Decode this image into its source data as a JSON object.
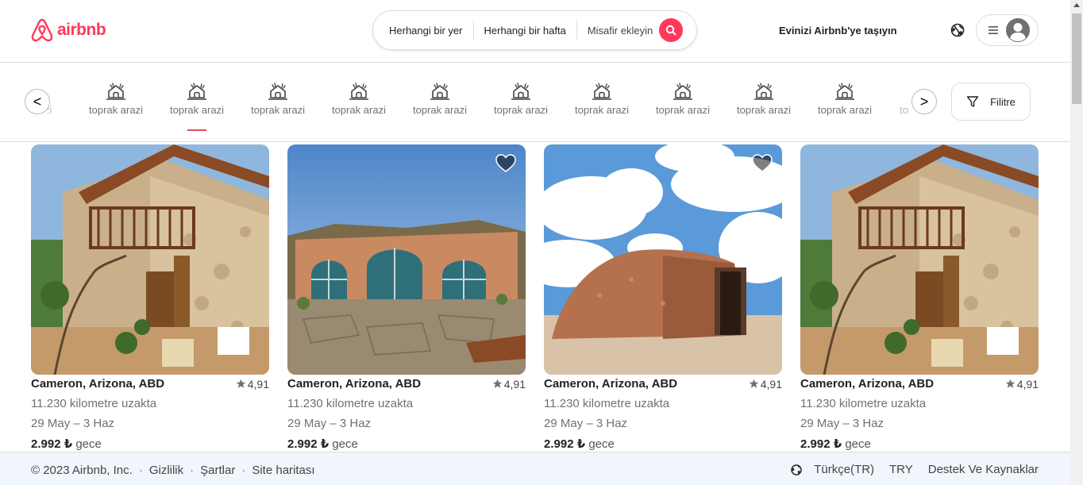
{
  "header": {
    "logo_text": "airbnb",
    "search": {
      "where": "Herhangi bir yer",
      "when": "Herhangi bir hafta",
      "guests": "Misafir ekleyin"
    },
    "host_link": "Evinizi Airbnb'ye taşıyın"
  },
  "categories": {
    "partial_left": "azi",
    "items": [
      "toprak arazi",
      "toprak arazi",
      "toprak arazi",
      "toprak arazi",
      "toprak arazi",
      "toprak arazi",
      "toprak arazi",
      "toprak arazi",
      "toprak arazi",
      "toprak arazi"
    ],
    "partial_right": "top",
    "active_index": 1,
    "prev_label": "<",
    "next_label": ">",
    "filter_label": "Filitre"
  },
  "listings": [
    {
      "title": "Cameron, Arizona, ABD",
      "rating": "4,91",
      "distance": "11.230 kilometre uzakta",
      "dates": "29 May – 3 Haz",
      "price": "2.992 ₺",
      "unit": "gece"
    },
    {
      "title": "Cameron, Arizona, ABD",
      "rating": "4,91",
      "distance": "11.230 kilometre uzakta",
      "dates": "29 May – 3 Haz",
      "price": "2.992 ₺",
      "unit": "gece"
    },
    {
      "title": "Cameron, Arizona, ABD",
      "rating": "4,91",
      "distance": "11.230 kilometre uzakta",
      "dates": "29 May – 3 Haz",
      "price": "2.992 ₺",
      "unit": "gece"
    },
    {
      "title": "Cameron, Arizona, ABD",
      "rating": "4,91",
      "distance": "11.230 kilometre uzakta",
      "dates": "29 May – 3 Haz",
      "price": "2.992 ₺",
      "unit": "gece"
    }
  ],
  "footer": {
    "copyright": "© 2023 Airbnb, Inc.",
    "links": [
      "Gizlilik",
      "Şartlar",
      "Site haritası"
    ],
    "language": "Türkçe(TR)",
    "currency": "TRY",
    "support": "Destek Ve Kaynaklar"
  },
  "colors": {
    "brand": "#ff385c",
    "active_underline": "#e04e4e",
    "footer_bg": "#f1f6fc"
  }
}
